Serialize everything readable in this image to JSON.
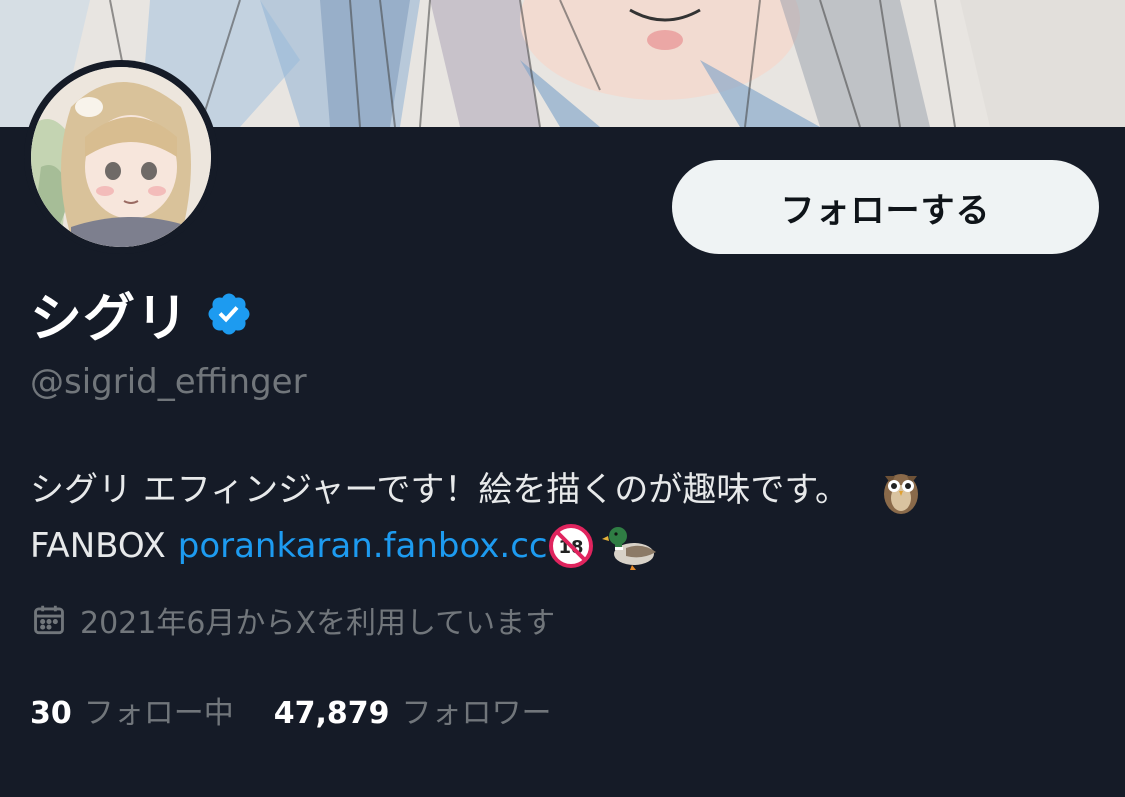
{
  "profile": {
    "display_name": "シグリ",
    "handle": "@sigrid_effinger",
    "verified": true,
    "follow_button_label": "フォローする"
  },
  "bio": {
    "line1_text": "シグリ エフィンジャーです！絵を描くのが趣味です。",
    "line1_emoji": "owl",
    "line2_prefix": "FANBOX ",
    "line2_link": "porankaran.fanbox.cc",
    "line2_emojis": [
      "no-one-under-eighteen",
      "duck"
    ]
  },
  "joined": {
    "icon": "calendar-icon",
    "text": "2021年6月からXを利用しています"
  },
  "stats": {
    "following_count": "30",
    "following_label": "フォロー中",
    "followers_count": "47,879",
    "followers_label": "フォロワー"
  },
  "colors": {
    "background": "#151b27",
    "link": "#1d9bf0",
    "muted": "#71767b",
    "verified": "#1d9bf0",
    "button_bg": "#eff3f4"
  }
}
